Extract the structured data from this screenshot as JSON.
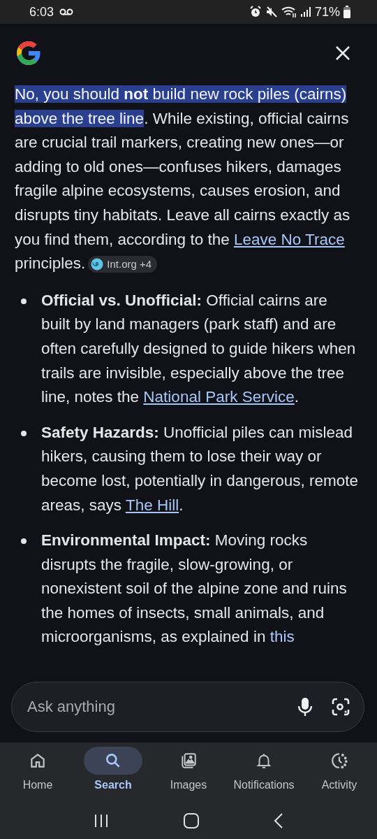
{
  "status_bar": {
    "time": "6:03",
    "battery": "71%"
  },
  "answer": {
    "highlight": "No, you should **not** build new rock piles (cairns) above the tree line",
    "text": ". While existing, official cairns are crucial trail markers, creating new ones—or adding to old ones—confuses hikers, damages fragile alpine ecosystems, causes erosion, and disrupts tiny habitats. Leave all cairns exactly as you find them, according to the ",
    "link": "Leave No Trace",
    "text_after": " principles.",
    "source_chip": "Int.org +4"
  },
  "bullets": [
    {
      "title": "Official vs. Unofficial:",
      "text": " Official cairns are built by land managers (park staff) and are often carefully designed to guide hikers when trails are invisible, especially above the tree line, notes the ",
      "link": "National Park Service",
      "link_underlined": true,
      "text_after": "."
    },
    {
      "title": "Safety Hazards:",
      "text": " Unofficial piles can mislead hikers, causing them to lose their way or become lost, potentially in dangerous, remote areas, says ",
      "link": "The Hill",
      "link_underlined": true,
      "text_after": "."
    },
    {
      "title": "Environmental Impact:",
      "text": " Moving rocks disrupts the fragile, slow-growing, or nonexistent soil of the alpine zone and ruins the homes of insects, small animals, and microorganisms, as explained in ",
      "link": "this",
      "link_underlined": false
    }
  ],
  "ask_bar": {
    "placeholder": "Ask anything"
  },
  "bottom_nav": [
    {
      "label": "Home",
      "selected": false
    },
    {
      "label": "Search",
      "selected": true
    },
    {
      "label": "Images",
      "selected": false
    },
    {
      "label": "Notifications",
      "selected": false
    },
    {
      "label": "Activity",
      "selected": false
    }
  ]
}
